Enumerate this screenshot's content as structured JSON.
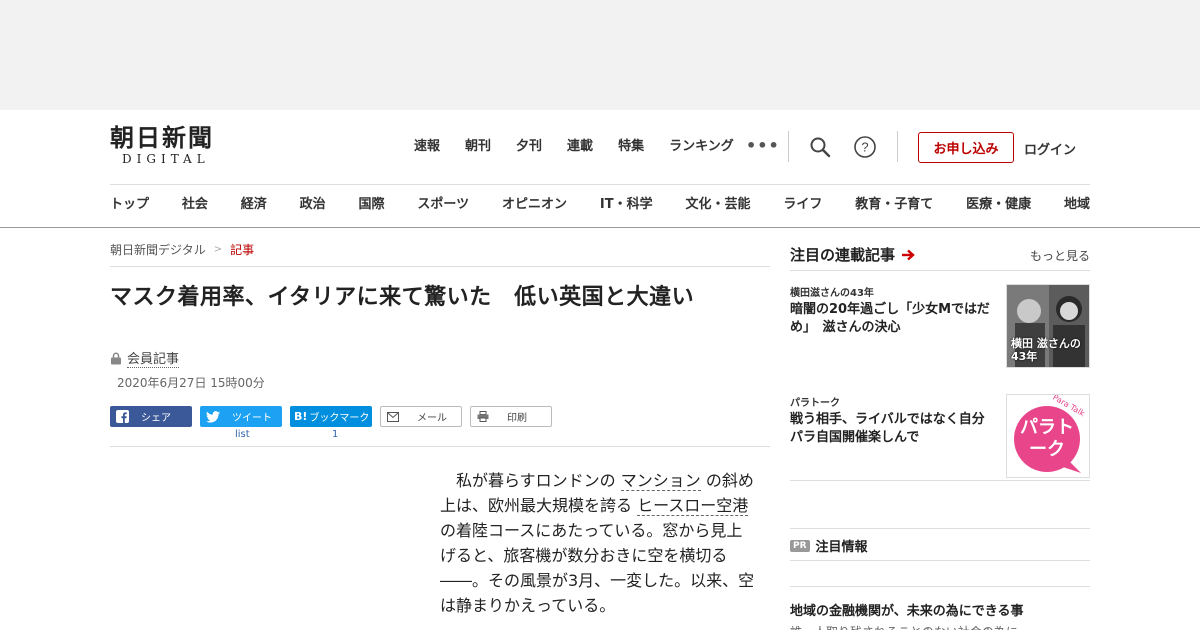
{
  "site": {
    "logo_main": "朝日新聞",
    "logo_sub": "DIGITAL"
  },
  "top_nav": [
    "速報",
    "朝刊",
    "夕刊",
    "連載",
    "特集",
    "ランキング"
  ],
  "header_actions": {
    "more": "•••",
    "apply_label": "お申し込み",
    "login_label": "ログイン"
  },
  "category_nav": [
    "トップ",
    "社会",
    "経済",
    "政治",
    "国際",
    "スポーツ",
    "オピニオン",
    "IT・科学",
    "文化・芸能",
    "ライフ",
    "教育・子育て",
    "医療・健康",
    "地域"
  ],
  "breadcrumb": {
    "home": "朝日新聞デジタル",
    "separator": ">",
    "current": "記事"
  },
  "article": {
    "title": "マスク着用率、イタリアに来て驚いた　低い英国と大違い",
    "member_label": "会員記事",
    "date": "2020年6月27日 15時00分",
    "body_parts": {
      "p1a": "私が暮らすロンドンの",
      "p1b": "マンション",
      "p1c": "の斜め上は、欧州最大規模を誇る",
      "p1d": "ヒースロー空港",
      "p1e": "の着陸コースにあたっている。窓から見上げると、旅客機が数分おきに空を横切る――。その風景が3月、一変した。以来、空は静まりかえっている。"
    }
  },
  "share": {
    "facebook": "シェア",
    "twitter": "ツイート",
    "hatena": "ブックマーク",
    "hatena_mark": "B!",
    "mail": "メール",
    "print": "印刷",
    "twitter_count": "list",
    "hatena_count": "1"
  },
  "sidebar": {
    "heading": "注目の連載記事",
    "more": "もっと見る",
    "items": [
      {
        "kicker": "横田滋さんの43年",
        "headline": "暗闇の20年過ごし「少女Mではだめ」　滋さんの決心",
        "thumb_text": "横田 滋さんの43年"
      },
      {
        "kicker": "パラトーク",
        "headline": "戦う相手、ライバルではなく自分　パラ自国開催楽しんで",
        "thumb_text": "パラトーク",
        "thumb_tag": "Para Talk"
      }
    ],
    "pr_badge": "PR",
    "pr_heading": "注目情報",
    "pr_title": "地域の金融機関が、未来の為にできる事",
    "pr_sub": "誰一人取り残されることのない社会の為に"
  },
  "colors": {
    "brand_red": "#b00000",
    "facebook": "#3b5998",
    "twitter": "#1da1f2",
    "hatena": "#008fde",
    "para_pink": "#e8458b"
  }
}
